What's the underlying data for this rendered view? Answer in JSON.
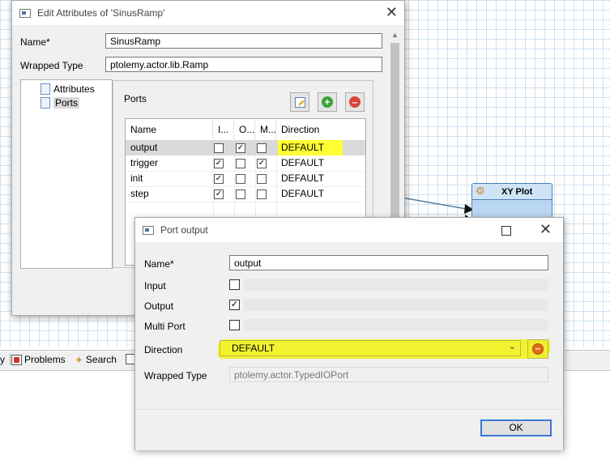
{
  "edit_dialog": {
    "title": "Edit Attributes of 'SinusRamp'",
    "name_label": "Name*",
    "name_value": "SinusRamp",
    "wrapped_type_label": "Wrapped Type",
    "wrapped_type_value": "ptolemy.actor.lib.Ramp",
    "tree": [
      {
        "label": "Attributes"
      },
      {
        "label": "Ports"
      }
    ],
    "ports_group_label": "Ports",
    "table": {
      "headers": [
        "Name",
        "I...",
        "O...",
        "M...",
        "Direction"
      ],
      "rows": [
        {
          "name": "output",
          "input": false,
          "output": true,
          "multi": false,
          "direction": "DEFAULT"
        },
        {
          "name": "trigger",
          "input": true,
          "output": false,
          "multi": true,
          "direction": "DEFAULT"
        },
        {
          "name": "init",
          "input": true,
          "output": false,
          "multi": false,
          "direction": "DEFAULT"
        },
        {
          "name": "step",
          "input": true,
          "output": false,
          "multi": false,
          "direction": "DEFAULT"
        }
      ]
    }
  },
  "canvas": {
    "actor_label": "XY Plot"
  },
  "bottom_tabs": [
    {
      "label": "y"
    },
    {
      "label": "Problems"
    },
    {
      "label": "Search"
    }
  ],
  "port_dialog": {
    "title": "Port output",
    "name_label": "Name*",
    "name_value": "output",
    "input_label": "Input",
    "input_checked": false,
    "output_label": "Output",
    "output_checked": true,
    "multi_label": "Multi Port",
    "multi_checked": false,
    "direction_label": "Direction",
    "direction_value": "DEFAULT",
    "wrapped_type_label": "Wrapped Type",
    "wrapped_type_value": "ptolemy.actor.TypedIOPort",
    "ok_label": "OK"
  },
  "colors": {
    "highlight": "#ffff33",
    "actor_fill": "#b9d7f2",
    "actor_border": "#4d7fb5",
    "remove_red": "#d9443c",
    "add_green": "#3aa33a"
  }
}
